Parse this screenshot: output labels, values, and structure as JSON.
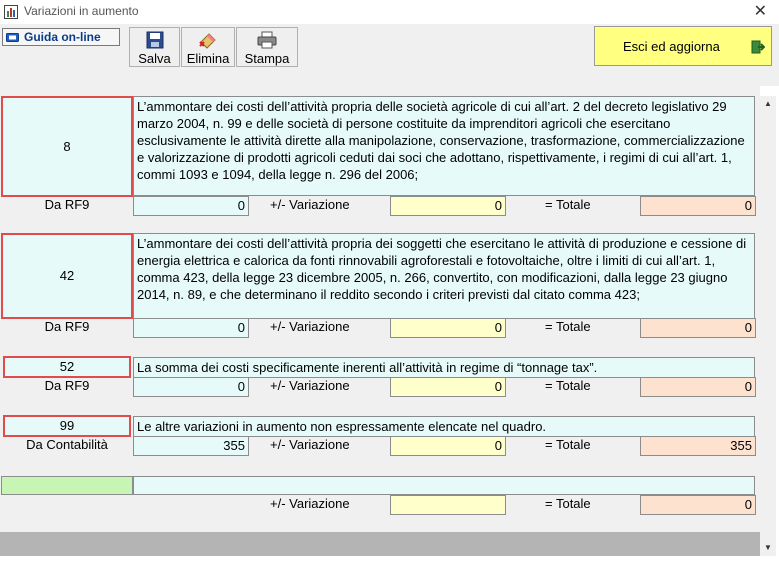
{
  "window": {
    "title": "Variazioni in aumento",
    "close_symbol": "✕"
  },
  "toolbar": {
    "guida_label": "Guida on-line",
    "salva_label": "Salva",
    "elimina_label": "Elimina",
    "stampa_label": "Stampa",
    "esci_label": "Esci ed aggiorna"
  },
  "common": {
    "variazione_label": "+/-  Variazione",
    "totale_label": "= Totale"
  },
  "sections": [
    {
      "code": "8",
      "description": "L’ammontare dei costi dell’attività propria delle società agricole di cui all’art. 2 del decreto legislativo 29 marzo 2004, n. 99 e delle società di persone costituite da imprenditori agricoli che esercitano esclusivamente le attività dirette alla manipolazione, conservazione, trasformazione, commercializzazione e valorizzazione di prodotti agricoli ceduti dai soci che adottano, rispettivamente, i regimi di cui all’art. 1, commi 1093 e 1094, della legge n. 296 del 2006;",
      "source_label": "Da RF9",
      "source_value": "0",
      "variazione_value": "0",
      "totale_value": "0"
    },
    {
      "code": "42",
      "description": "L’ammontare dei costi dell’attività propria dei soggetti che esercitano le attività di produzione e cessione di energia elettrica e calorica da fonti rinnovabili agroforestali e fotovoltaiche, oltre i limiti di cui all’art. 1, comma 423, della legge 23 dicembre 2005, n. 266, convertito, con modificazioni, dalla legge 23 giugno 2014, n. 89, e che determinano il reddito secondo i criteri previsti dal citato comma 423;",
      "source_label": "Da RF9",
      "source_value": "0",
      "variazione_value": "0",
      "totale_value": "0"
    },
    {
      "code": "52",
      "description": "La somma dei costi specificamente inerenti all’attività in regime di “tonnage tax”.",
      "source_label": "Da RF9",
      "source_value": "0",
      "variazione_value": "0",
      "totale_value": "0"
    },
    {
      "code": "99",
      "description": "Le altre variazioni in aumento non espressamente elencate nel quadro.",
      "source_label": "Da Contabilità",
      "source_value": "355",
      "variazione_value": "0",
      "totale_value": "355"
    }
  ],
  "extra_row": {
    "code": "",
    "description": "",
    "variazione_value": "",
    "totale_value": "0"
  },
  "colors": {
    "code_border": "#e04c4c",
    "field_cyan": "#e6fafa",
    "field_yellow": "#ffffcc",
    "field_peach": "#fde3cf",
    "esci_bg": "#ffff80",
    "extra_code_green": "#c6f5b4"
  }
}
